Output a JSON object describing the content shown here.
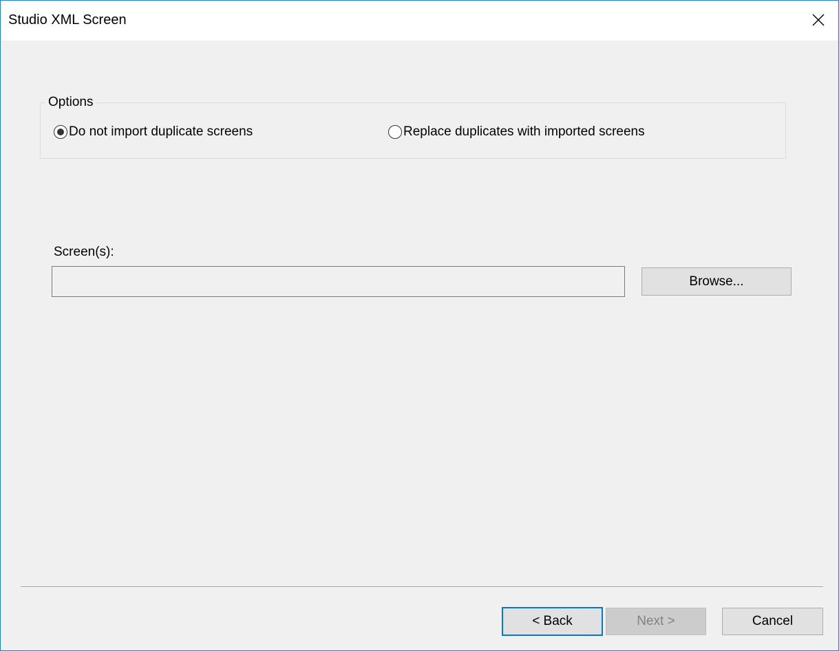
{
  "window": {
    "title": "Studio XML Screen",
    "close_icon": "close-icon"
  },
  "options": {
    "legend": "Options",
    "radios": [
      {
        "label": "Do not import duplicate screens",
        "checked": true
      },
      {
        "label": "Replace duplicates with imported screens",
        "checked": false
      }
    ]
  },
  "screens": {
    "label": "Screen(s):",
    "value": "",
    "browse_label": "Browse..."
  },
  "footer": {
    "back_label": "< Back",
    "next_label": "Next >",
    "next_enabled": false,
    "cancel_label": "Cancel"
  },
  "colors": {
    "window_border": "#1883d7",
    "dialog_background": "#f0f0f0",
    "focus_border": "#0078d7"
  }
}
